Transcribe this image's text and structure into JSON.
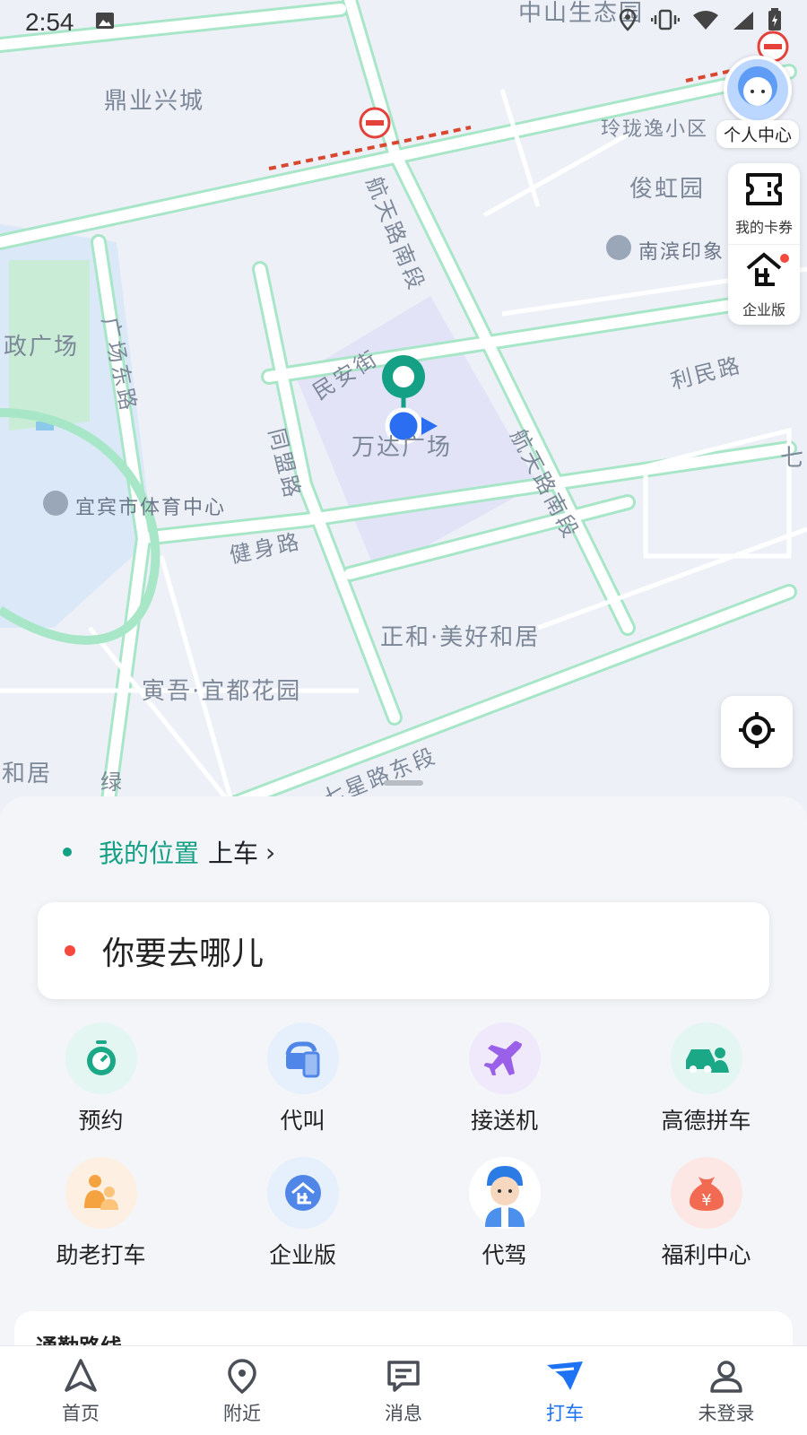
{
  "status_bar": {
    "time": "2:54"
  },
  "map": {
    "place_labels": [
      "中山生态园",
      "鼎业兴城",
      "玲珑逸小区",
      "俊虹园",
      "南滨印象",
      "政广场",
      "宜宾市体育中心",
      "万达广场",
      "正和·美好和居",
      "寅吾·宜都花园",
      "和居",
      "七"
    ],
    "road_labels": [
      "航天路南段",
      "民安街",
      "利民路",
      "广场东路",
      "同盟路",
      "健身路",
      "航天路南段",
      "七星路东段",
      "绿"
    ]
  },
  "side_tools": {
    "profile_label": "个人中心",
    "coupons_label": "我的卡券",
    "enterprise_label": "企业版"
  },
  "pickup": {
    "location": "我的位置",
    "action": "上车"
  },
  "destination": {
    "placeholder": "你要去哪儿"
  },
  "services": [
    {
      "label": "预约",
      "icon": "clock-icon",
      "bg": "#e3f6f1",
      "fg": "#1aa886"
    },
    {
      "label": "代叫",
      "icon": "car-phone-icon",
      "bg": "#e6effc",
      "fg": "#4f86e8"
    },
    {
      "label": "接送机",
      "icon": "airplane-icon",
      "bg": "#f0e8fb",
      "fg": "#9a61e8"
    },
    {
      "label": "高德拼车",
      "icon": "carpool-icon",
      "bg": "#e3f6f1",
      "fg": "#1aa886"
    },
    {
      "label": "助老打车",
      "icon": "elder-icon",
      "bg": "#fdf0e2",
      "fg": "#f5a341"
    },
    {
      "label": "企业版",
      "icon": "enterprise-icon",
      "bg": "#e6effc",
      "fg": "#4f86e8"
    },
    {
      "label": "代驾",
      "icon": "driver-avatar-icon",
      "bg": "#ffffff",
      "fg": "#2b7be5"
    },
    {
      "label": "福利中心",
      "icon": "money-bag-icon",
      "bg": "#fde7e4",
      "fg": "#f26a51"
    }
  ],
  "commute": {
    "title": "通勤路线"
  },
  "nav": [
    {
      "label": "首页",
      "icon": "home-arrow-icon"
    },
    {
      "label": "附近",
      "icon": "location-pin-icon"
    },
    {
      "label": "消息",
      "icon": "message-icon"
    },
    {
      "label": "打车",
      "icon": "taxi-icon"
    },
    {
      "label": "未登录",
      "icon": "user-icon"
    }
  ],
  "colors": {
    "accent": "#1e73f5",
    "brand_green": "#14a085",
    "dest_red": "#f5493d",
    "road": "#a8e6c8"
  }
}
